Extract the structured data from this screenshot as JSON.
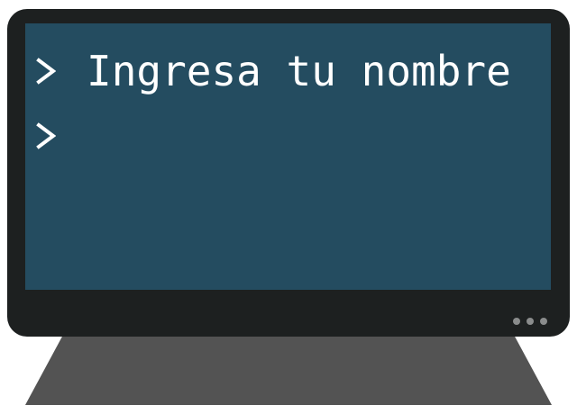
{
  "terminal": {
    "lines": [
      {
        "prompt_icon": "prompt-chevron-icon",
        "text": "Ingresa tu nombre"
      },
      {
        "prompt_icon": "prompt-chevron-icon",
        "text": ""
      }
    ]
  },
  "colors": {
    "screen": "#244c60",
    "bezel": "#1d2020",
    "stand": "#535353",
    "text": "#ffffff",
    "indicator_dots": "#8a8c8c"
  },
  "indicator": {
    "dot_count": 3
  }
}
